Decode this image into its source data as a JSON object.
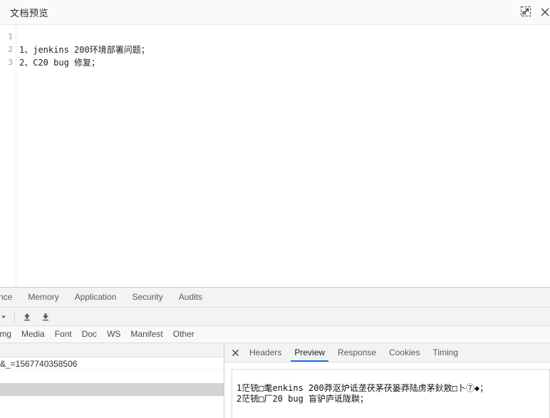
{
  "doc_preview": {
    "title": "文档预览",
    "expand_icon": "expand-icon",
    "close_icon": "close-icon",
    "lines": [
      {
        "no": "1",
        "text": ""
      },
      {
        "no": "2",
        "text": "1、jenkins 200环境部署问题；"
      },
      {
        "no": "3",
        "text": "2、C20 bug 修复；"
      }
    ]
  },
  "devtools": {
    "panel_tabs": [
      {
        "label": "nce"
      },
      {
        "label": "Memory"
      },
      {
        "label": "Application"
      },
      {
        "label": "Security"
      },
      {
        "label": "Audits"
      }
    ],
    "toolbar": {
      "chevron_icon": "chevron-down-icon",
      "import_icon": "import-har-icon",
      "export_icon": "export-har-icon"
    },
    "filters": [
      {
        "label": "Img"
      },
      {
        "label": "Media"
      },
      {
        "label": "Font"
      },
      {
        "label": "Doc"
      },
      {
        "label": "WS"
      },
      {
        "label": "Manifest"
      },
      {
        "label": "Other"
      }
    ],
    "requests": [
      {
        "name": "&_=1567740358506",
        "selected": false
      },
      {
        "name": "",
        "selected": false
      },
      {
        "name": "",
        "selected": true
      }
    ],
    "detail": {
      "close_icon": "close-icon",
      "tabs": [
        {
          "label": "Headers",
          "active": false
        },
        {
          "label": "Preview",
          "active": true
        },
        {
          "label": "Response",
          "active": false
        },
        {
          "label": "Cookies",
          "active": false
        },
        {
          "label": "Timing",
          "active": false
        }
      ],
      "preview_lines": [
        "1茫铳□耄enkins 200莽沤炉诋垄茯茅茯篓莽陆虏茅鈥敫□卜⑦◆；",
        "2茫铳□厂20 bug 盲驴庐诋陇聫；"
      ]
    }
  },
  "colors": {
    "accent": "#1a73e8",
    "panel_bg": "#f3f3f3",
    "selected_row": "#d3d3d3"
  }
}
